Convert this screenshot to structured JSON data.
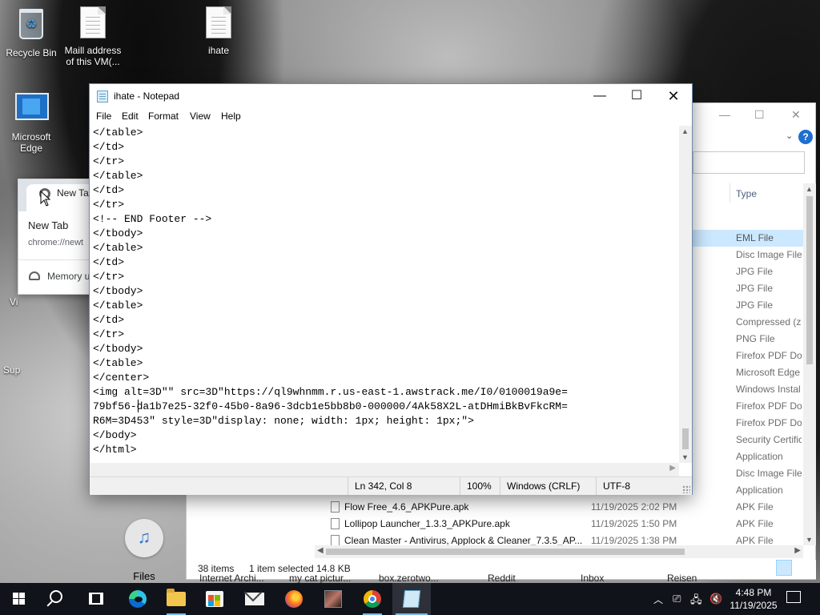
{
  "desktop": {
    "icons": [
      {
        "label": "Recycle Bin",
        "icon": "recycle-bin-icon"
      },
      {
        "label": "Maill address of this VM(...",
        "icon": "text-file-icon"
      },
      {
        "label": "ihate",
        "icon": "text-file-icon"
      },
      {
        "label": "Microsoft Edge",
        "icon": "edge-shortcut-icon"
      }
    ],
    "partial_labels": [
      "Vi",
      "Sup"
    ]
  },
  "chrome_hover_card": {
    "tab_title": "New Tab",
    "title": "New Tab",
    "url": "chrome://newt",
    "memory_text": "Memory u"
  },
  "files_launcher": {
    "label": "Files"
  },
  "notepad": {
    "title": "ihate - Notepad",
    "menu": [
      "File",
      "Edit",
      "Format",
      "View",
      "Help"
    ],
    "lines": [
      "</table>",
      "</td>",
      "</tr>",
      "</table>",
      "</td>",
      "</tr>",
      "<!-- END Footer -->",
      "</tbody>",
      "</table>",
      "</td>",
      "</tr>",
      "</tbody>",
      "</table>",
      "</td>",
      "</tr>",
      "</tbody>",
      "</table>",
      "</center>",
      "<img alt=3D\"\" src=3D\"https://ql9whnmm.r.us-east-1.awstrack.me/I0/0100019a9e=",
      "79bf56-da1b7e25-32f0-45b0-8a96-3dcb1e5bb8b0-000000/4Ak58X2L-atDHmiBkBvFkcRM=",
      "R6M=3D453\" style=3D\"display: none; width: 1px; height: 1px;\">",
      "</body>",
      "</html>"
    ],
    "status": {
      "position": "Ln 342, Col 8",
      "zoom": "100%",
      "line_ending": "Windows (CRLF)",
      "encoding": "UTF-8"
    }
  },
  "explorer": {
    "column_header_type": "Type",
    "rows": [
      {
        "name": "",
        "date": "",
        "type": "EML File",
        "selected": true
      },
      {
        "name": "",
        "date": "",
        "type": "Disc Image File"
      },
      {
        "name": "",
        "date": "",
        "type": "JPG File"
      },
      {
        "name": "",
        "date": "",
        "type": "JPG File"
      },
      {
        "name": "",
        "date": "",
        "type": "JPG File"
      },
      {
        "name": "",
        "date": "",
        "type": "Compressed (zi"
      },
      {
        "name": "",
        "date": "",
        "type": "PNG File"
      },
      {
        "name": "",
        "date": "",
        "type": "Firefox PDF Doc"
      },
      {
        "name": "",
        "date": "",
        "type": "Microsoft Edge"
      },
      {
        "name": "",
        "date": "",
        "type": "Windows Instal"
      },
      {
        "name": "",
        "date": "",
        "type": "Firefox PDF Doc"
      },
      {
        "name": "",
        "date": "",
        "type": "Firefox PDF Doc"
      },
      {
        "name": "",
        "date": "",
        "type": "Security Certific"
      },
      {
        "name": "",
        "date": "",
        "type": "Application"
      },
      {
        "name": "",
        "date": "",
        "type": "Disc Image File"
      },
      {
        "name": "",
        "date": "",
        "type": "Application"
      },
      {
        "name": "Flow Free_4.6_APKPure.apk",
        "date": "11/19/2025 2:02 PM",
        "type": "APK File"
      },
      {
        "name": "Lollipop Launcher_1.3.3_APKPure.apk",
        "date": "11/19/2025 1:50 PM",
        "type": "APK File"
      },
      {
        "name": "Clean Master - Antivirus, Applock & Cleaner_7.3.5_AP...",
        "date": "11/19/2025 1:38 PM",
        "type": "APK File"
      }
    ],
    "status": {
      "count": "38 items",
      "selection": "1 item selected",
      "size": "14.8 KB"
    },
    "behind_labels": [
      "Internet Archi...",
      "my cat pictur...",
      "box.zerotwo...",
      "Reddit",
      "Inbox",
      "Reisen"
    ]
  },
  "taskbar": {
    "clock_time": "4:48 PM",
    "clock_date": "11/19/2025",
    "apps": [
      "start",
      "search",
      "task-view",
      "edge",
      "file-explorer",
      "store",
      "mail",
      "firefox",
      "photo-app",
      "chrome",
      "notepad"
    ]
  },
  "colors": {
    "taskbar": "#101319",
    "accent": "#76b9ed",
    "selection": "#cce8ff",
    "help_blue": "#1f6fd1"
  }
}
